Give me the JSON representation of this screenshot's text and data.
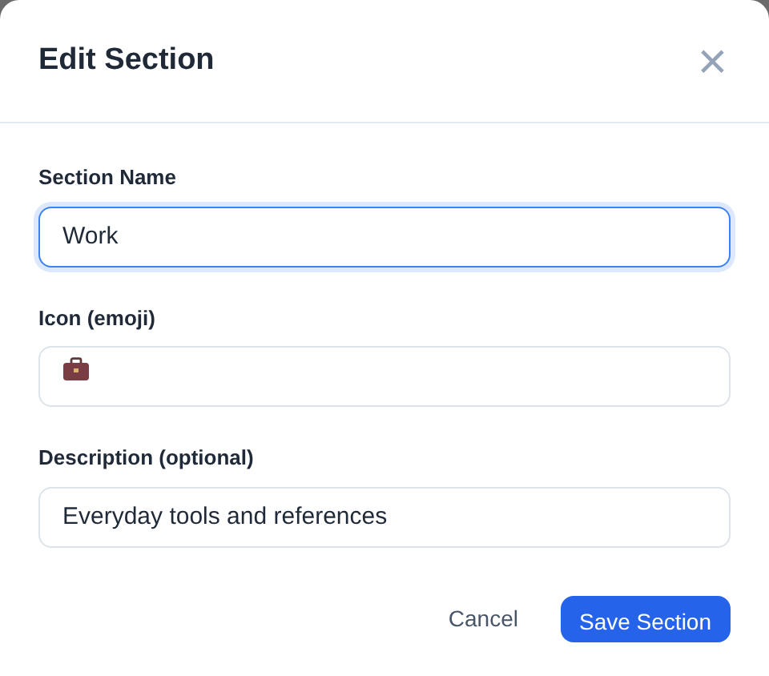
{
  "dialog": {
    "title": "Edit Section",
    "close": "×"
  },
  "fields": [
    {
      "label": "Section Name",
      "value": "Work",
      "focused": true,
      "kind": "text"
    },
    {
      "label": "Icon (emoji)",
      "focused": false,
      "kind": "icon"
    },
    {
      "label": "Description (optional)",
      "value": "Everyday tools and references",
      "focused": false,
      "kind": "text"
    }
  ],
  "buttons": [
    {
      "label": "Cancel",
      "kind": "secondary"
    },
    {
      "label": "Save Section",
      "kind": "primary"
    }
  ]
}
